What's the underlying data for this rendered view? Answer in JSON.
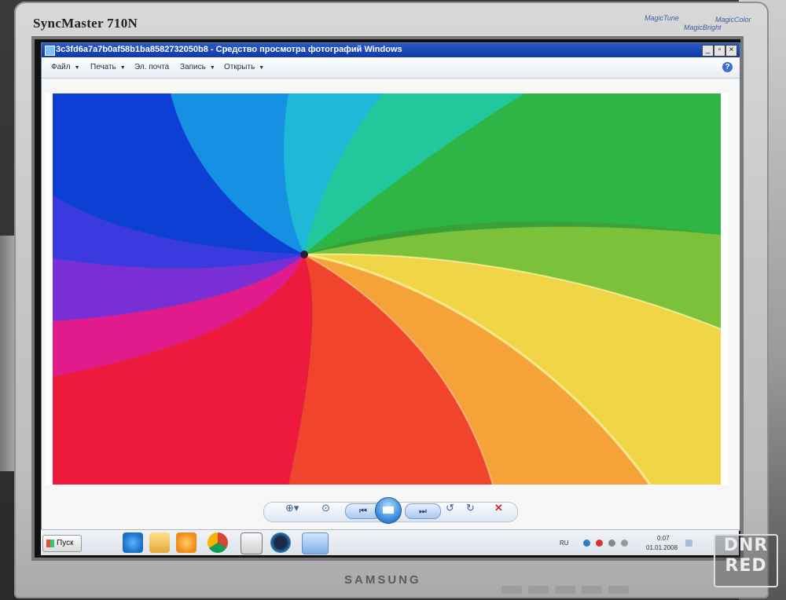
{
  "monitor": {
    "model": "SyncMaster 710N",
    "brand": "SAMSUNG",
    "logos": [
      "MagicTune",
      "MagicBright",
      "MagicColor"
    ]
  },
  "window": {
    "title": "3c3fd6a7a7b0af58b1ba8582732050b8 - Средство просмотра фотографий Windows",
    "menu": [
      "Файл",
      "Печать",
      "Эл. почта",
      "Запись",
      "Открыть"
    ],
    "help": "?"
  },
  "colors": {
    "titlebar": "#1a47b8",
    "swirl": [
      "#0b3fd1",
      "#1aa7e8",
      "#2bd0a8",
      "#39c24a",
      "#7cc43b",
      "#f0d94a",
      "#f7a63a",
      "#f2492c",
      "#e8186c",
      "#7a33d6"
    ]
  },
  "taskbar": {
    "start_label": "Пуск",
    "language": "RU",
    "time": "0:07",
    "date": "01.01.2008",
    "icons": [
      "ie-icon",
      "folder-icon",
      "media-player-icon",
      "chrome-icon",
      "counter-icon",
      "ccleaner-icon",
      "photo-viewer-icon"
    ]
  },
  "watermark": {
    "line1": "DNR",
    "line2": "RED"
  }
}
